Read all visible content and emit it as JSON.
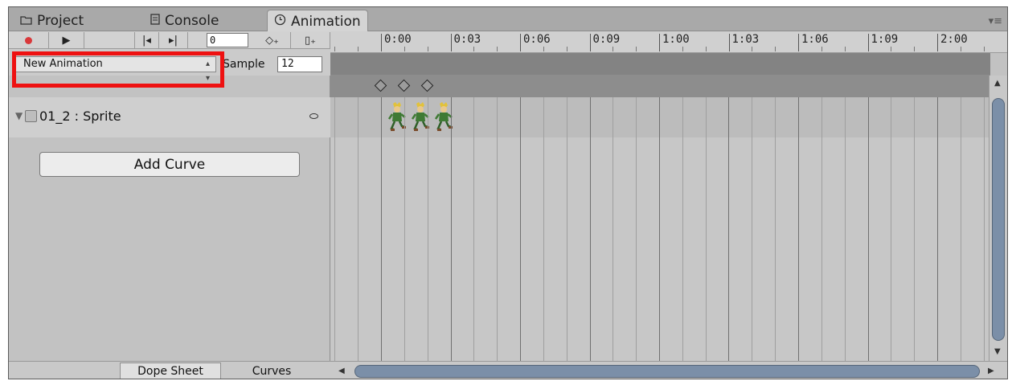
{
  "tabs": [
    {
      "label": "Project",
      "icon": "folder-icon"
    },
    {
      "label": "Console",
      "icon": "console-icon"
    },
    {
      "label": "Animation",
      "icon": "clock-icon",
      "active": true
    }
  ],
  "toolbar": {
    "record_icon": "record-icon",
    "play_icon": "play-icon",
    "prev_key_icon": "prev-keyframe-icon",
    "next_key_icon": "next-keyframe-icon",
    "frame_value": "0",
    "add_keyframe_icon": "add-keyframe-icon",
    "add_event_icon": "add-event-icon"
  },
  "ruler": {
    "labels": [
      "0:00",
      "0:03",
      "0:06",
      "0:09",
      "1:00",
      "1:03",
      "1:06",
      "1:09",
      "2:00"
    ]
  },
  "clip": {
    "selected": "New Animation",
    "sample_label": "Sample",
    "sample_value": "12"
  },
  "property": {
    "label": "01_2 : Sprite"
  },
  "add_curve_label": "Add Curve",
  "bottom_tabs": {
    "dope_sheet": "Dope Sheet",
    "curves": "Curves"
  },
  "keyframes_count": 3,
  "colors": {
    "highlight": "#ee1111",
    "record": "#d9383a",
    "scroll_thumb": "#7b8fa8"
  }
}
